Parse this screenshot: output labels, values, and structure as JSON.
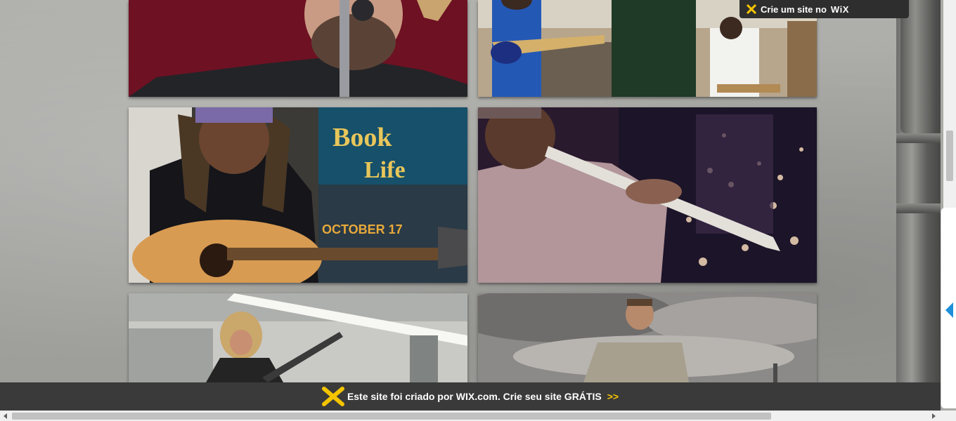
{
  "wix_top_badge": {
    "text": "Crie um site no",
    "brand": "WiX",
    "icon": "wix-star-icon"
  },
  "gallery": {
    "photos": [
      {
        "subject": "singer-at-microphone"
      },
      {
        "subject": "subway-guitar-and-drum-buskers"
      },
      {
        "subject": "woman-singing-with-acoustic-guitar",
        "poster_text": [
          "Book",
          "Life",
          "OCTOBER 17"
        ]
      },
      {
        "subject": "saxophone-player-city-night"
      },
      {
        "subject": "rock-guitarist-subway-station"
      },
      {
        "subject": "man-with-guitar-cloudy-skyline"
      }
    ]
  },
  "wix_bar": {
    "message": "Este site foi criado por WIX.com. Crie seu site GRÁTIS",
    "cta": ">>",
    "icon": "wix-logo-icon"
  },
  "colors": {
    "bar_bg": "#3a3a3a",
    "cta": "#f5c400",
    "side_arrow": "#1e8fd9"
  }
}
